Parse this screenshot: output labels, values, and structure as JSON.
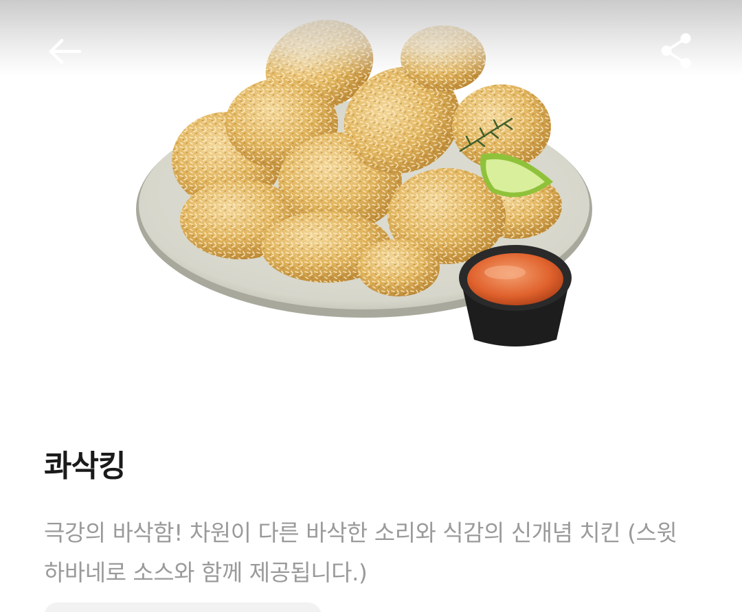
{
  "header": {
    "back_icon": "arrow-left-icon",
    "share_icon": "share-icon"
  },
  "product": {
    "image_alt": "coconut crusted fried chicken on a plate with dipping sauce",
    "name": "콰삭킹",
    "description": "극강의 바삭함! 차원이 다른 바삭한 소리와 식감의 신개념 치킨 (스윗 하바네로 소스와 함께 제공됩니다.)"
  },
  "colors": {
    "title": "#1a1a1a",
    "description": "#9a9a9a",
    "background": "#ffffff"
  }
}
